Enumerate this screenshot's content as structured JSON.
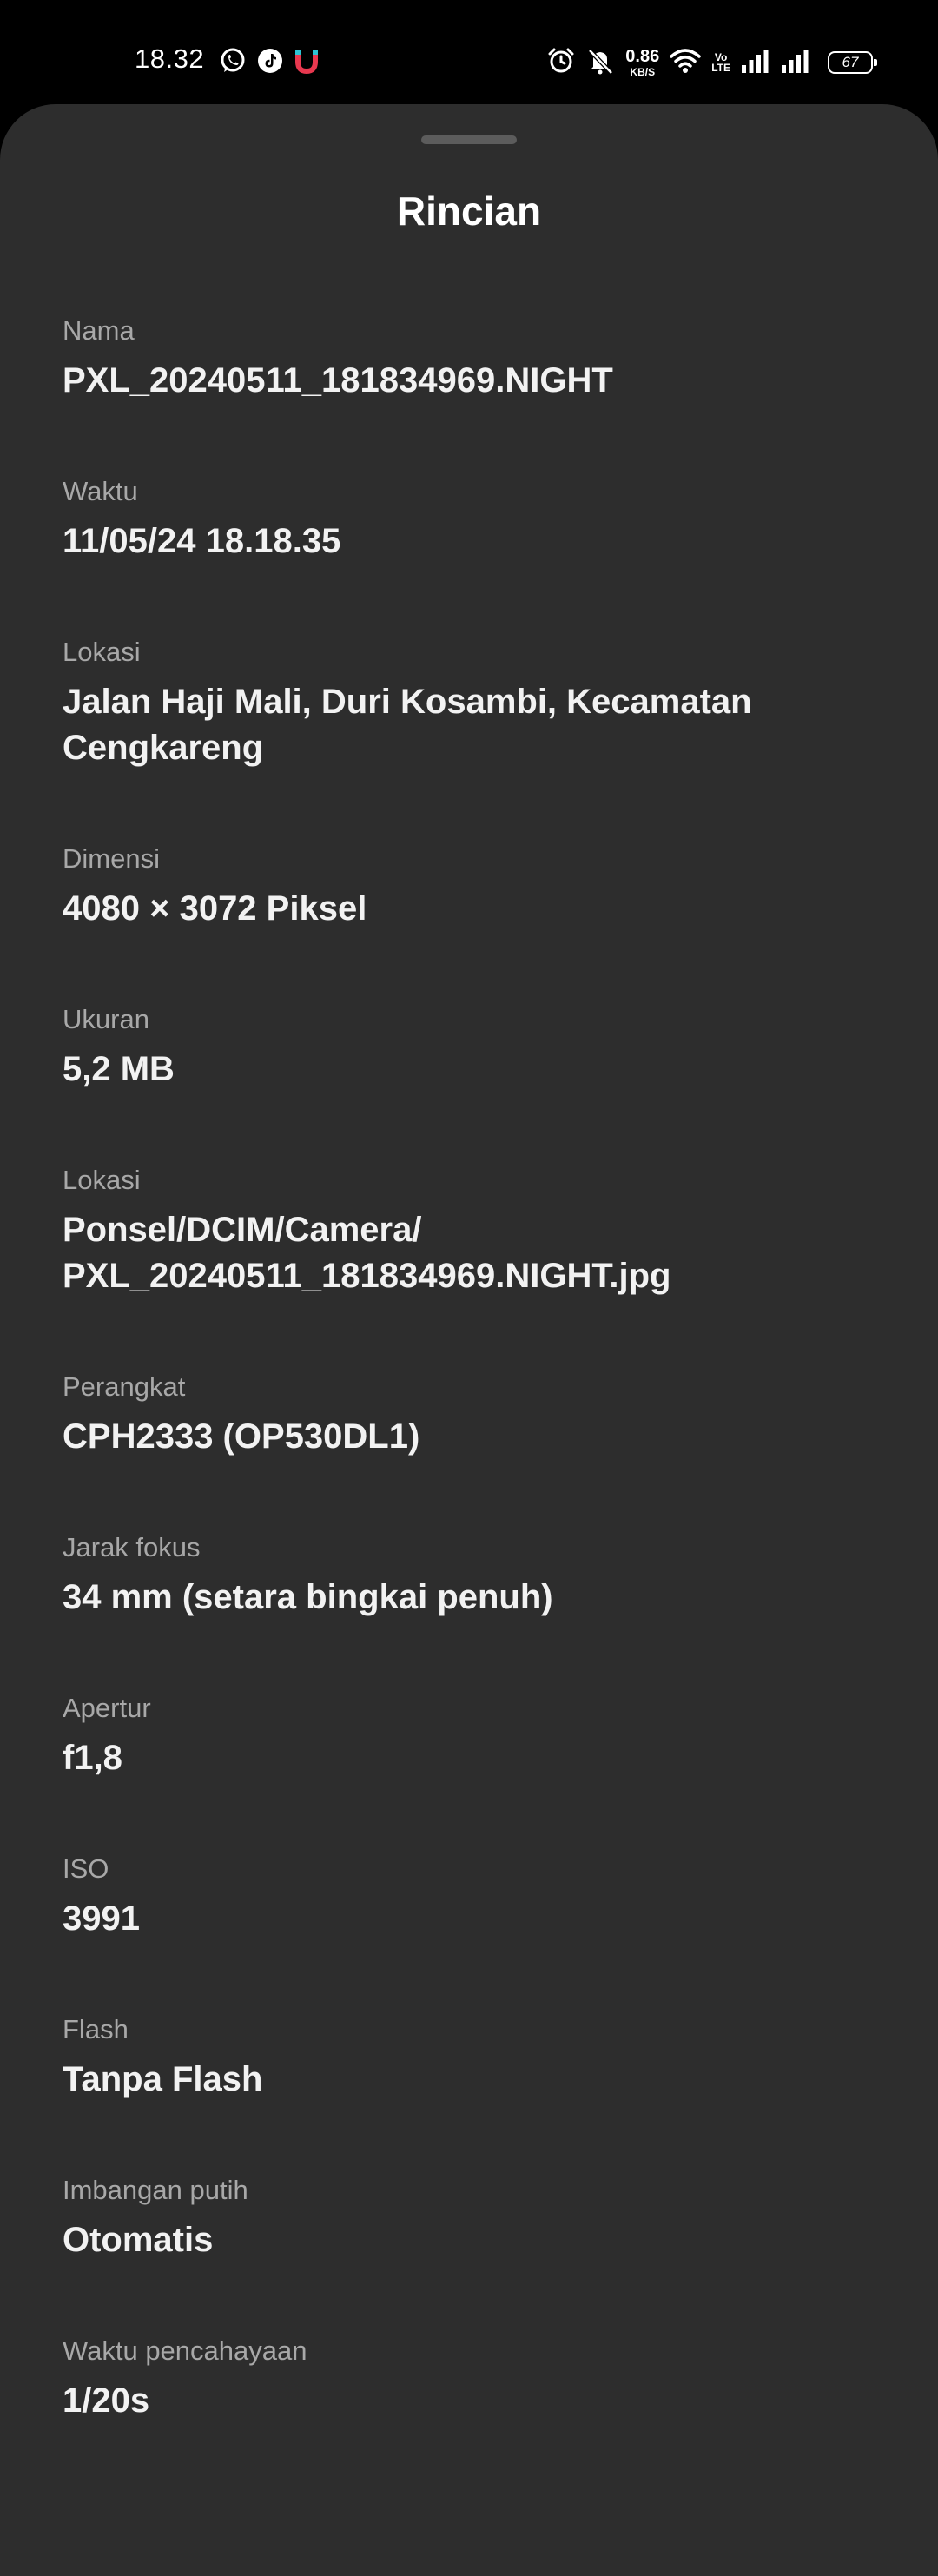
{
  "status_bar": {
    "time": "18.32",
    "net_speed_value": "0.86",
    "net_speed_unit": "KB/S",
    "volte_top": "Vo",
    "volte_bottom": "LTE",
    "battery": "67",
    "icons": [
      "whatsapp-icon",
      "tiktok-icon",
      "magnet-icon",
      "alarm-icon",
      "mute-icon",
      "wifi-icon",
      "signal-1-icon",
      "signal-2-icon",
      "battery-icon"
    ]
  },
  "sheet": {
    "title": "Rincian"
  },
  "details": [
    {
      "label": "Nama",
      "value": "PXL_20240511_181834969.NIGHT"
    },
    {
      "label": "Waktu",
      "value": "11/05/24 18.18.35"
    },
    {
      "label": "Lokasi",
      "value": "Jalan Haji Mali, Duri Kosambi, Kecamatan Cengkareng"
    },
    {
      "label": "Dimensi",
      "value": "4080 × 3072 Piksel"
    },
    {
      "label": "Ukuran",
      "value": "5,2 MB"
    },
    {
      "label": "Lokasi",
      "value": "Ponsel/DCIM/Camera/ PXL_20240511_181834969.NIGHT.jpg"
    },
    {
      "label": "Perangkat",
      "value": "CPH2333 (OP530DL1)"
    },
    {
      "label": "Jarak fokus",
      "value": "34 mm (setara bingkai penuh)"
    },
    {
      "label": "Apertur",
      "value": "f1,8"
    },
    {
      "label": "ISO",
      "value": "3991"
    },
    {
      "label": "Flash",
      "value": "Tanpa Flash"
    },
    {
      "label": "Imbangan putih",
      "value": "Otomatis"
    },
    {
      "label": "Waktu pencahayaan",
      "value": "1/20s"
    }
  ],
  "colors": {
    "background": "#000000",
    "sheet": "#2d2d2d",
    "label": "#a8a8a8",
    "value": "#f2f2f2",
    "magnet_red": "#e8384f",
    "magnet_teal": "#2bc4d4"
  }
}
